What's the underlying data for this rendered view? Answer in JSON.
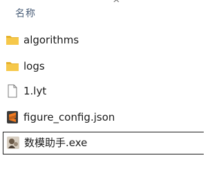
{
  "header": {
    "name_column_label": "名称",
    "sort_indicator": "^"
  },
  "files": [
    {
      "name": "algorithms",
      "icon": "folder-icon",
      "type": "folder"
    },
    {
      "name": "logs",
      "icon": "folder-icon",
      "type": "folder"
    },
    {
      "name": "1.lyt",
      "icon": "blank-file-icon",
      "type": "file"
    },
    {
      "name": "figure_config.json",
      "icon": "sublime-text-file-icon",
      "type": "file"
    },
    {
      "name": "数模助手.exe",
      "icon": "app-exe-icon",
      "type": "file",
      "selected": true
    }
  ],
  "colors": {
    "folder_yellow": "#f0c040",
    "header_text": "#4c607a",
    "sublime_orange": "#f07b22"
  }
}
